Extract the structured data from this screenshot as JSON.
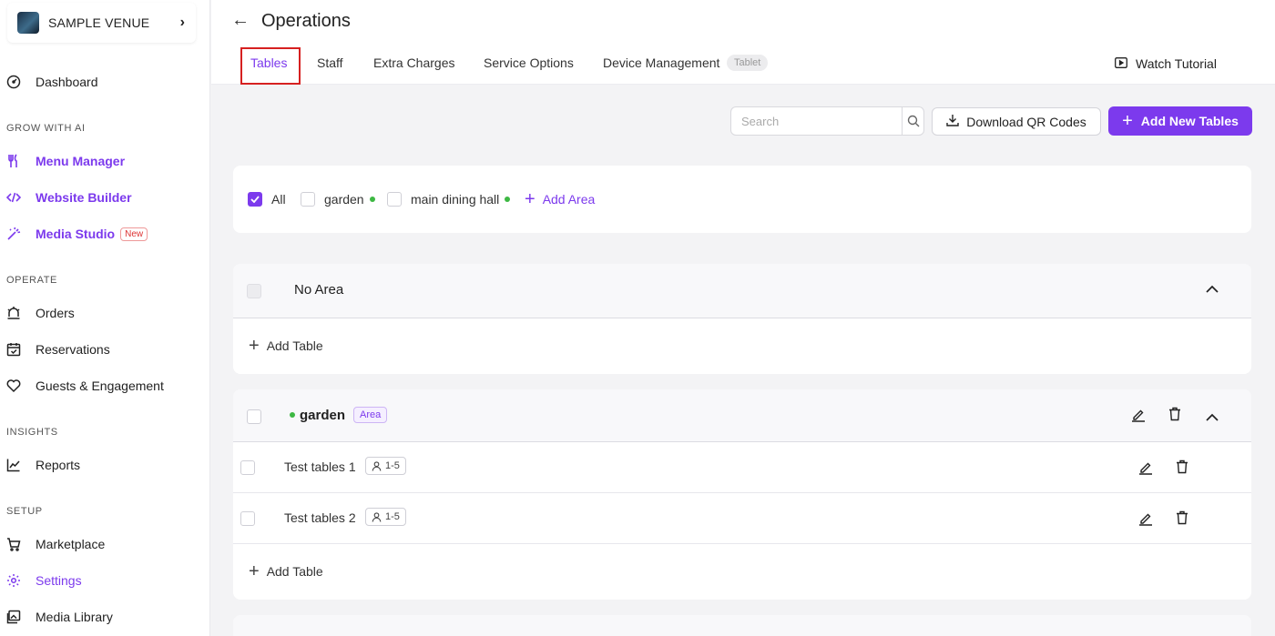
{
  "sidebar": {
    "venue_name": "SAMPLE VENUE",
    "dashboard": "Dashboard",
    "section_grow": "GROW WITH AI",
    "menu_manager": "Menu Manager",
    "website_builder": "Website Builder",
    "media_studio": "Media Studio",
    "new_badge": "New",
    "section_operate": "OPERATE",
    "orders": "Orders",
    "reservations": "Reservations",
    "guests": "Guests & Engagement",
    "section_insights": "INSIGHTS",
    "reports": "Reports",
    "section_setup": "SETUP",
    "marketplace": "Marketplace",
    "settings": "Settings",
    "media_library": "Media Library"
  },
  "header": {
    "title": "Operations",
    "tabs": [
      "Tables",
      "Staff",
      "Extra Charges",
      "Service Options",
      "Device Management"
    ],
    "tablet_chip": "Tablet",
    "watch_tutorial": "Watch Tutorial"
  },
  "toolbar": {
    "search_placeholder": "Search",
    "download_qr": "Download QR Codes",
    "add_new_tables": "Add New Tables"
  },
  "filters": {
    "all": "All",
    "garden": "garden",
    "main_dining_hall": "main dining hall",
    "add_area": "Add Area"
  },
  "areas": {
    "no_area_title": "No Area",
    "add_table": "Add Table",
    "garden_name": "garden",
    "area_chip": "Area",
    "garden_tables": [
      {
        "name": "Test tables 1",
        "capacity": "1-5"
      },
      {
        "name": "Test tables 2",
        "capacity": "1-5"
      }
    ]
  },
  "colors": {
    "accent": "#7c3aed",
    "status_active": "#3db843",
    "highlight_box": "#d62020"
  }
}
